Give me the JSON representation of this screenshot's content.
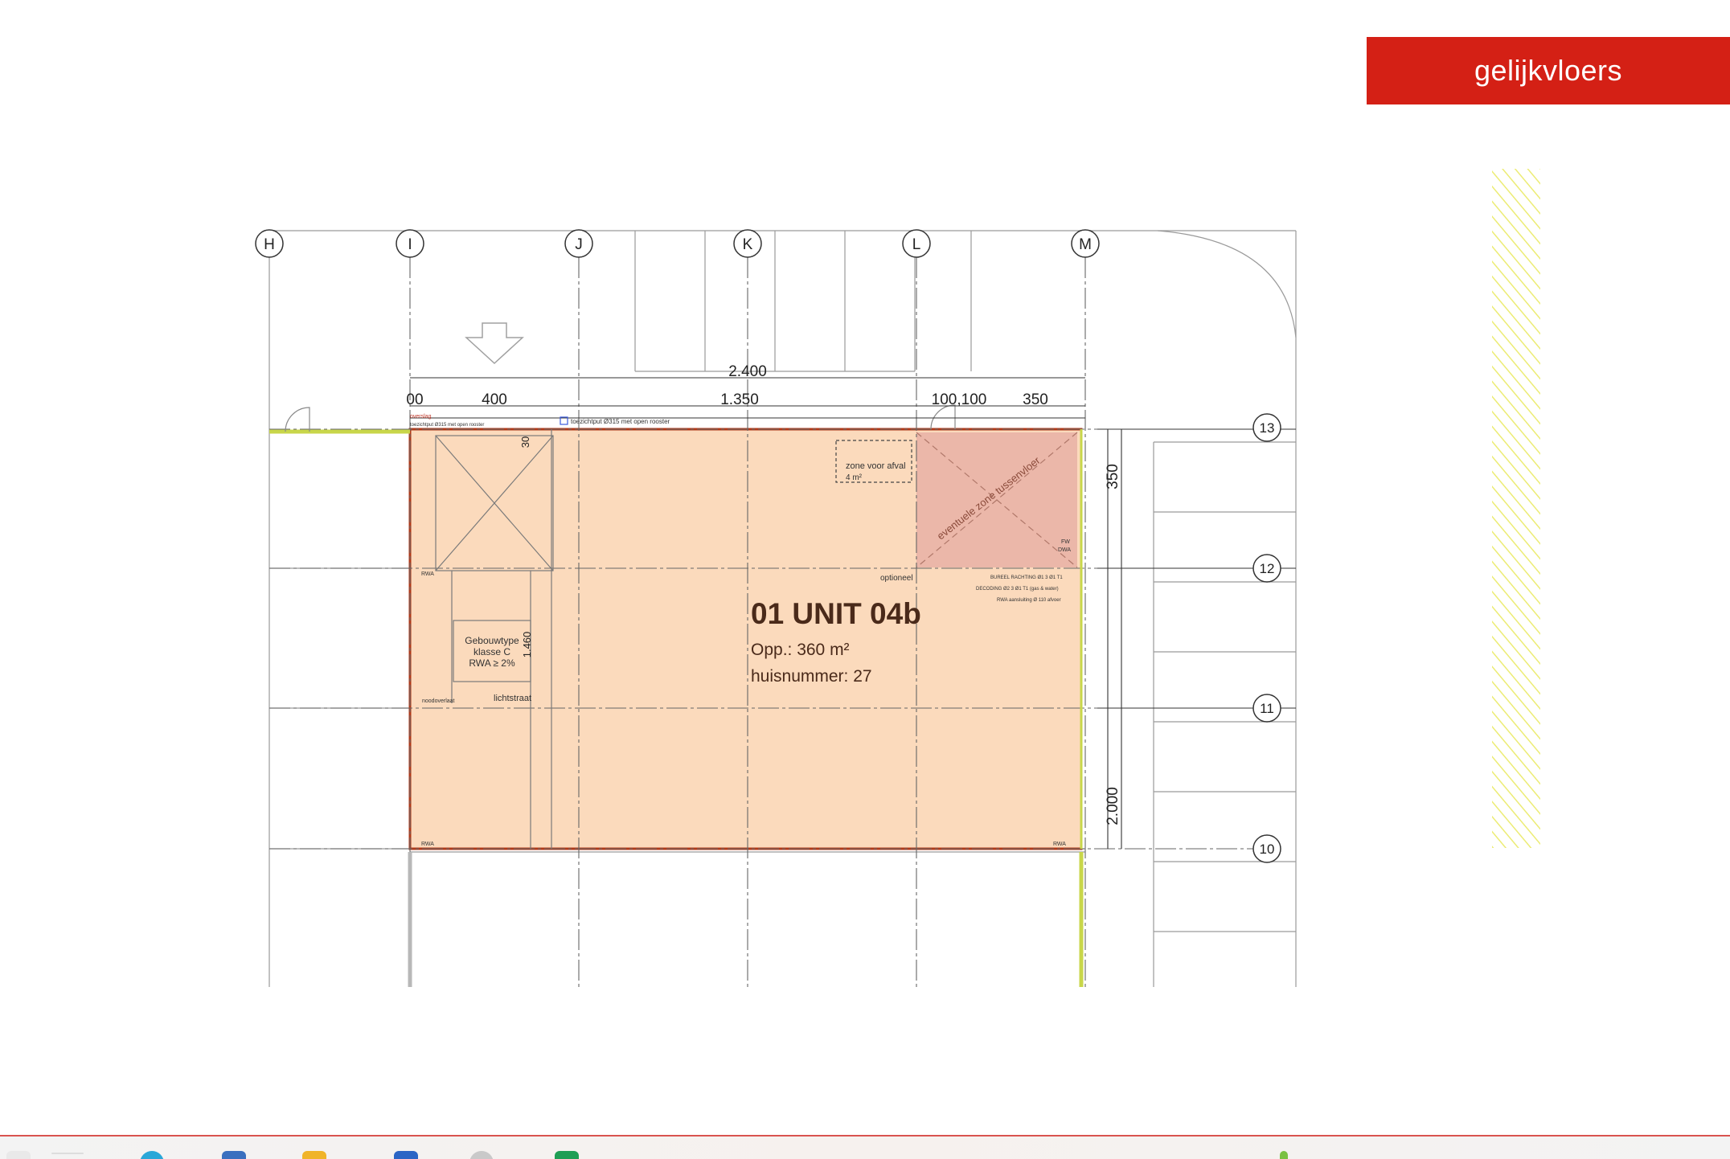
{
  "banner": {
    "label": "gelijkvloers",
    "color": "#d42015"
  },
  "plan": {
    "grid_columns": [
      "H",
      "I",
      "J",
      "K",
      "L",
      "M"
    ],
    "grid_rows": [
      "13",
      "12",
      "11",
      "10"
    ],
    "dimensions": {
      "total": "2.400",
      "seg_first": "00",
      "seg_400": "400",
      "seg_1350": "1.350",
      "seg_100": "100,100",
      "seg_350": "350",
      "vertical_350": "350",
      "vertical_2000": "2.000",
      "small_1460": "1.460",
      "small_30": "30"
    },
    "unit": {
      "title": "01 UNIT 04b",
      "area": "Opp.: 360 m²",
      "house_number": "huisnummer: 27"
    },
    "notes": {
      "waste_zone": "zone voor afval",
      "waste_area": "4 m²",
      "mezzanine": "eventuele zone tussenvloer",
      "building_type_1": "Gebouwtype",
      "building_type_2": "klasse C",
      "building_type_3": "RWA ≥ 2%",
      "skylight": "lichtstraat",
      "optional": "optioneel",
      "inspection_pit": "toezichtput Ø315 met open rooster",
      "overflow": "noodoverlaat",
      "rwa": "RWA",
      "rwa_2": "RWA",
      "rwa_3": "RWA",
      "dwa": "DWA",
      "fw": "FW",
      "spec_1": "BUREEL RACHTING Ø1 3 Ø1 T1",
      "spec_2": "DECODING Ø2 3 Ø1 T1 (gas & water)",
      "spec_3": "RWA aansluiting Ø 110 afvoer",
      "left_tag_1": "overslag",
      "left_tag_2": "toezichtput Ø315 met open rooster"
    },
    "colors": {
      "unit_fill": "#fbdabc",
      "unit_border": "#b03a1a",
      "mezz_fill": "#ebb7a9",
      "grid": "#555555",
      "hatch": "#ecec74"
    }
  },
  "taskbar": {
    "icons": [
      "start-icon",
      "search-icon",
      "edge-icon",
      "file-explorer-icon",
      "store-icon",
      "word-icon",
      "chrome-icon",
      "excel-icon"
    ]
  }
}
